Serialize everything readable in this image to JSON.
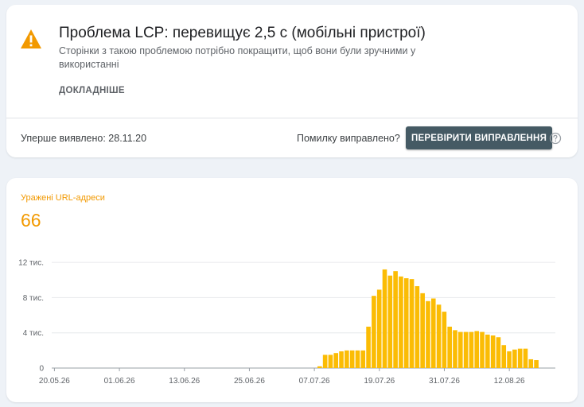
{
  "issue": {
    "title": "Проблема LCP: перевищує 2,5 с (мобільні пристрої)",
    "description": "Сторінки з такою проблемою потрібно покращити, щоб вони були зручними у використанні",
    "details_label": "ДОКЛАДНІШЕ",
    "first_detected": "Уперше виявлено: 28.11.20",
    "fixed_question": "Помилку виправлено?",
    "validate_button": "ПЕРЕВІРИТИ ВИПРАВЛЕННЯ",
    "warning_icon": "warning-triangle-icon",
    "help_icon": "help-circle-icon",
    "warning_color": "#f29900"
  },
  "metric": {
    "label": "Уражені URL-адреси",
    "value": "66",
    "color": "#f29900"
  },
  "chart_data": {
    "type": "bar",
    "bar_color": "#fbbc04",
    "grid": true,
    "ylim": [
      0,
      13000
    ],
    "y_ticks": [
      {
        "value": 0,
        "label": "0"
      },
      {
        "value": 4000,
        "label": "4 тис."
      },
      {
        "value": 8000,
        "label": "8 тис."
      },
      {
        "value": 12000,
        "label": "12 тис."
      }
    ],
    "x_tick_labels": [
      "20.05.26",
      "01.06.26",
      "13.06.26",
      "25.06.26",
      "07.07.26",
      "19.07.26",
      "31.07.26",
      "12.08.26"
    ],
    "x_tick_indices": [
      0,
      12,
      24,
      36,
      48,
      60,
      72,
      84
    ],
    "values": [
      0,
      0,
      0,
      0,
      0,
      0,
      0,
      0,
      0,
      0,
      0,
      0,
      0,
      0,
      0,
      0,
      0,
      0,
      0,
      0,
      0,
      0,
      0,
      0,
      0,
      0,
      0,
      0,
      0,
      0,
      0,
      0,
      0,
      0,
      0,
      0,
      0,
      0,
      0,
      0,
      0,
      0,
      0,
      0,
      0,
      0,
      0,
      0,
      0,
      200,
      1500,
      1500,
      1700,
      1900,
      2000,
      2000,
      2000,
      2000,
      4700,
      8200,
      8900,
      11200,
      10500,
      11000,
      10400,
      10200,
      10100,
      9300,
      8500,
      7600,
      7900,
      7200,
      6400,
      4700,
      4300,
      4100,
      4100,
      4100,
      4200,
      4100,
      3800,
      3700,
      3500,
      2600,
      1900,
      2100,
      2200,
      2200,
      1000,
      900,
      0,
      0,
      0
    ]
  }
}
